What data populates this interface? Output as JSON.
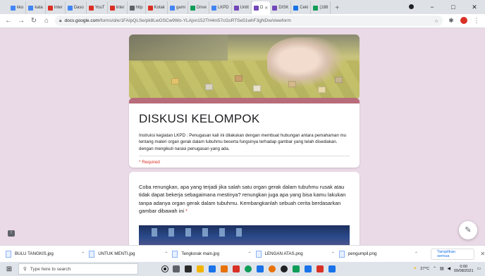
{
  "browser": {
    "tabs": [
      {
        "label": "kko",
        "color": "#4285f4"
      },
      {
        "label": "kata",
        "color": "#4285f4"
      },
      {
        "label": "Inter",
        "color": "#d93025"
      },
      {
        "label": "Daso",
        "color": "#4285f4"
      },
      {
        "label": "YouT",
        "color": "#d93025"
      },
      {
        "label": "Inter",
        "color": "#d93025"
      },
      {
        "label": "http",
        "color": "#5f6368"
      },
      {
        "label": "Kotak",
        "color": "#d93025"
      },
      {
        "label": "gami",
        "color": "#4285f4"
      },
      {
        "label": "Drive",
        "color": "#0f9d58"
      },
      {
        "label": "LKPD",
        "color": "#4285f4"
      },
      {
        "label": "Untit",
        "color": "#7248b9"
      },
      {
        "label": "D",
        "color": "#7248b9",
        "active": true
      },
      {
        "label": "DISK",
        "color": "#7248b9"
      },
      {
        "label": "Ceki",
        "color": "#1a73e8"
      },
      {
        "label": "(188",
        "color": "#0f9d58"
      }
    ],
    "new_tab": "+",
    "window_controls": {
      "minimize": "−",
      "maximize": "□",
      "close": "✕"
    },
    "url_host": "docs.google.com",
    "url_path": "/forms/d/e/1FAIpQLSe/pk8LwOSCw9Wo-YLAjxn152TH4m57cGsRTSe51whF3gNDw/viewform"
  },
  "form": {
    "title": "DISKUSI KELOMPOK",
    "description": "Instruksi kegiatan LKPD : Penugasan kali ini dilakukan dengan membuat hubungan antara pemahaman mu tentang materi organ gerak dalam tubuhmu beserta fungsinya terhadap gambar yang telah disediakan. dengan mengikuti narasi penugasan yang ada.",
    "required_note": "* Required",
    "accent_color": "#b86c7a",
    "question": {
      "text": "Coba renungkan, apa yang terjadi jika salah satu organ gerak dalam tubuhmu rusak atau tidak dapat bekerja sebagaimana mestinya? renungkan juga apa yang bisa kamu lakukan tanpa adanya organ gerak dalam tubuhmu. Kembangkanlah sebuah cerita berdasarkan gambar dibawah ini",
      "required_mark": "*"
    }
  },
  "downloads": {
    "items": [
      "BULU TANGKIS.jpg",
      "UNTUK MENTI.jpg",
      "Tengkorak main.jpg",
      "LENGAN ATAS.png",
      "pengumpil.png"
    ],
    "show_all": "Tampilkan semua",
    "close": "✕"
  },
  "taskbar": {
    "search_placeholder": "Type here to search",
    "weather": "27°C",
    "time": "0:00",
    "date": "09/08/2021"
  }
}
